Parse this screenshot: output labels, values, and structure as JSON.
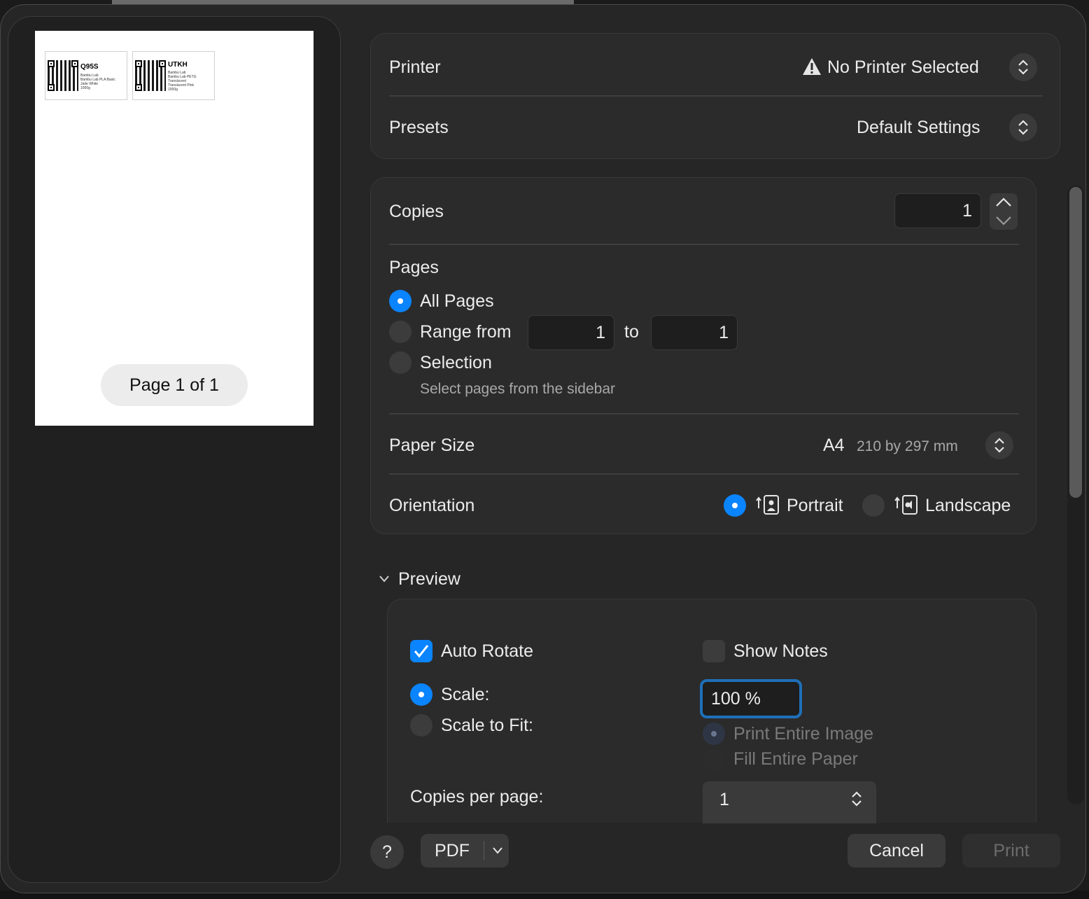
{
  "preview": {
    "labels": [
      {
        "id": "Q95S",
        "lines": [
          "Bambu Lab",
          "Bambu Lab PLA Basic",
          "Jade White",
          "1000g"
        ]
      },
      {
        "id": "UTKH",
        "lines": [
          "Bambu Lab",
          "Bambu Lab PETG",
          "Translucent",
          "Translucent Pink",
          "1000g"
        ]
      }
    ],
    "page_indicator": "Page 1 of 1"
  },
  "printer": {
    "label": "Printer",
    "value": "No Printer Selected",
    "icon": "warning-icon"
  },
  "presets": {
    "label": "Presets",
    "value": "Default Settings"
  },
  "copies": {
    "label": "Copies",
    "value": "1"
  },
  "pages": {
    "label": "Pages",
    "all_pages": "All Pages",
    "range_from": "Range from",
    "range_start": "1",
    "range_to": "to",
    "range_end": "1",
    "selection": "Selection",
    "selection_hint": "Select pages from the sidebar",
    "selected": "All Pages"
  },
  "paper_size": {
    "label": "Paper Size",
    "value": "A4",
    "detail": "210 by 297 mm"
  },
  "orientation": {
    "label": "Orientation",
    "portrait": "Portrait",
    "landscape": "Landscape",
    "selected": "Portrait"
  },
  "preview_section": {
    "title": "Preview",
    "auto_rotate": "Auto Rotate",
    "auto_rotate_checked": true,
    "show_notes": "Show Notes",
    "show_notes_checked": false,
    "scale": "Scale:",
    "scale_value": "100 %",
    "scale_to_fit": "Scale to Fit:",
    "print_entire_image": "Print Entire Image",
    "fill_entire_paper": "Fill Entire Paper",
    "copies_per_page": "Copies per page:",
    "copies_per_page_value": "1"
  },
  "footer": {
    "help": "?",
    "pdf": "PDF",
    "cancel": "Cancel",
    "print": "Print"
  },
  "colors": {
    "accent": "#0a84ff",
    "background": "#262626",
    "panel": "#2b2b2b"
  }
}
